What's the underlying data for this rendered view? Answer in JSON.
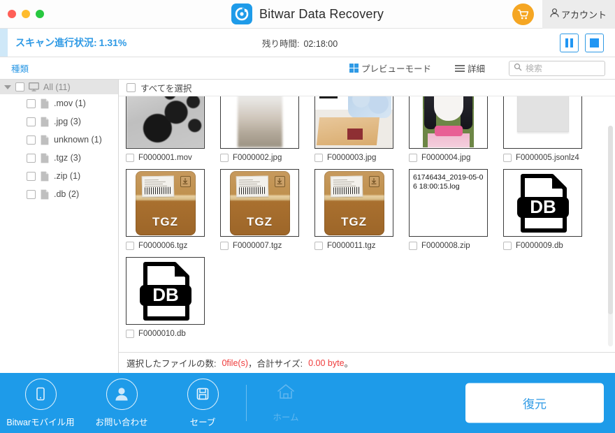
{
  "window": {
    "title": "Bitwar Data Recovery",
    "traffic_lights": [
      "close",
      "minimize",
      "maximize"
    ],
    "account_label": "アカウント",
    "cart_icon": "shopping-cart-icon",
    "logo_icon": "bitwar-logo-icon"
  },
  "progress": {
    "scan_label": "スキャン進行状況:",
    "scan_percent": "1.31%",
    "remaining_label": "残り時間:",
    "remaining_value": "02:18:00",
    "pause_icon": "pause-icon",
    "stop_icon": "stop-icon",
    "accent_color": "#2f9ae5"
  },
  "toolbar": {
    "kind_label": "種類",
    "preview_mode_label": "プレビューモード",
    "preview_mode_icon": "grid-view-icon",
    "detail_label": "詳細",
    "detail_icon": "list-view-icon",
    "search_icon": "search-icon",
    "search_placeholder": "検索",
    "search_value": ""
  },
  "sidebar": {
    "root": {
      "label": "All (11)",
      "icon": "monitor-icon",
      "expanded": true
    },
    "items": [
      {
        "label": ".mov (1)",
        "icon": "document-icon"
      },
      {
        "label": ".jpg (3)",
        "icon": "document-icon"
      },
      {
        "label": "unknown (1)",
        "icon": "document-icon"
      },
      {
        "label": ".tgz (3)",
        "icon": "document-icon"
      },
      {
        "label": ".zip (1)",
        "icon": "document-icon"
      },
      {
        "label": ".db (2)",
        "icon": "document-icon"
      }
    ]
  },
  "files": {
    "select_all_label": "すべてを選択",
    "items": [
      {
        "name": "F0000001.mov",
        "thumb": "film-reel-photo",
        "checked": false
      },
      {
        "name": "F0000002.jpg",
        "thumb": "blurred-photo",
        "checked": false
      },
      {
        "name": "F0000003.jpg",
        "thumb": "illustration-photo",
        "checked": false
      },
      {
        "name": "F0000004.jpg",
        "thumb": "character-photo",
        "checked": false
      },
      {
        "name": "F0000005.jsonlz4",
        "thumb": "blank-document",
        "checked": false
      },
      {
        "name": "F0000006.tgz",
        "thumb": "tgz-archive-icon",
        "thumb_text": "TGZ",
        "checked": false
      },
      {
        "name": "F0000007.tgz",
        "thumb": "tgz-archive-icon",
        "thumb_text": "TGZ",
        "checked": false
      },
      {
        "name": "F0000011.tgz",
        "thumb": "tgz-archive-icon",
        "thumb_text": "TGZ",
        "checked": false
      },
      {
        "name": "F0000008.zip",
        "thumb": "text-preview",
        "thumb_text": "61746434_2019-05-06 18:00:15.log",
        "checked": false
      },
      {
        "name": "F0000009.db",
        "thumb": "db-file-icon",
        "thumb_text": "DB",
        "checked": false
      },
      {
        "name": "F0000010.db",
        "thumb": "db-file-icon",
        "thumb_text": "DB",
        "checked": false
      }
    ]
  },
  "status": {
    "count_label": "選択したファイルの数:",
    "count_value": "0file(s)",
    "separator": "，",
    "size_label": "合計サイズ:",
    "size_value": "0.00 byte",
    "suffix": "。",
    "value_color": "#ef3b3b"
  },
  "footer": {
    "items": [
      {
        "label": "Bitwarモバイル用",
        "icon": "mobile-phone-icon",
        "disabled": false
      },
      {
        "label": "お問い合わせ",
        "icon": "person-icon",
        "disabled": false
      },
      {
        "label": "セーブ",
        "icon": "floppy-disk-icon",
        "disabled": false
      },
      {
        "label": "ホーム",
        "icon": "home-icon",
        "disabled": true
      }
    ],
    "restore_label": "復元",
    "background_color": "#1e9be9"
  }
}
